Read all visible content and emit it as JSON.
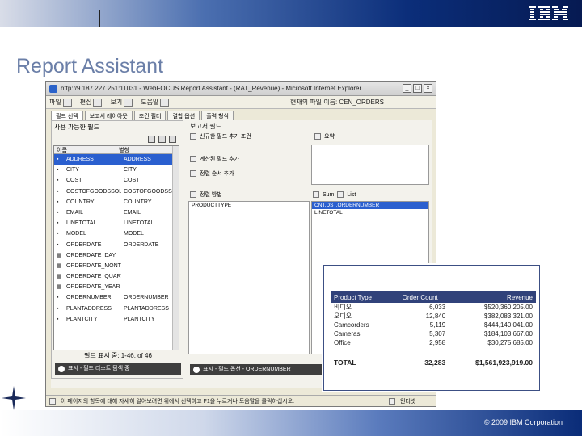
{
  "slide": {
    "title": "Report Assistant",
    "copyright": "© 2009 IBM Corporation",
    "logo": "IBM"
  },
  "window": {
    "title": "http://9.187.227.251:11031 - WebFOCUS Report Assistant - (RAT_Revenue) - Microsoft Internet Explorer",
    "min": "_",
    "max": "□",
    "close": "×"
  },
  "toolbar": {
    "file": "파일",
    "edit": "편집",
    "view": "보기",
    "help": "도움말",
    "active_file": "현재의 파일 이름: CEN_ORDERS"
  },
  "tabs": [
    "필드 선택",
    "보고서 레이아웃",
    "조건 필터",
    "결합 옵션",
    "출력 형식"
  ],
  "fields_panel": {
    "header": "사용 가능한 필드",
    "col_name": "이름",
    "col_alias": "별칭",
    "rows": [
      {
        "name": "ADDRESS",
        "alias": "ADDRESS",
        "selected": true,
        "icon": "field"
      },
      {
        "name": "CITY",
        "alias": "CITY",
        "selected": false,
        "icon": "field"
      },
      {
        "name": "COST",
        "alias": "COST",
        "selected": false,
        "icon": "field"
      },
      {
        "name": "COSTOFGOODSSOLD",
        "alias": "COSTOFGOODSSOLD",
        "selected": false,
        "icon": "field"
      },
      {
        "name": "COUNTRY",
        "alias": "COUNTRY",
        "selected": false,
        "icon": "field"
      },
      {
        "name": "EMAIL",
        "alias": "EMAIL",
        "selected": false,
        "icon": "field"
      },
      {
        "name": "LINETOTAL",
        "alias": "LINETOTAL",
        "selected": false,
        "icon": "field"
      },
      {
        "name": "MODEL",
        "alias": "MODEL",
        "selected": false,
        "icon": "field"
      },
      {
        "name": "ORDERDATE",
        "alias": "ORDERDATE",
        "selected": false,
        "icon": "field"
      },
      {
        "name": "ORDERDATE_DAY",
        "alias": "",
        "selected": false,
        "icon": "date"
      },
      {
        "name": "ORDERDATE_MONTH",
        "alias": "",
        "selected": false,
        "icon": "date"
      },
      {
        "name": "ORDERDATE_QUARTER",
        "alias": "",
        "selected": false,
        "icon": "date"
      },
      {
        "name": "ORDERDATE_YEAR",
        "alias": "",
        "selected": false,
        "icon": "date"
      },
      {
        "name": "ORDERNUMBER",
        "alias": "ORDERNUMBER",
        "selected": false,
        "icon": "field"
      },
      {
        "name": "PLANTADDRESS",
        "alias": "PLANTADDRESS",
        "selected": false,
        "icon": "field"
      },
      {
        "name": "PLANTCITY",
        "alias": "PLANTCITY",
        "selected": false,
        "icon": "field"
      }
    ],
    "count": "필드 표시 중: 1-46, of 46",
    "footer_btn": "표시 - 필드 리스트 탐색 중"
  },
  "right_panel": {
    "section_title": "보고서 필드",
    "compute_label": "신규한 필드 추가 조건",
    "summary_label": "요약",
    "check1": "계산된 필드 추가",
    "check2": "정렬 순서 추가",
    "sort_label": "정렬 방법",
    "sort_field": "PRODUCTTYPE",
    "sum_btn": "Sum",
    "list_btn": "List",
    "sum_items": [
      "CNT.DST.ORDERNUMBER",
      "LINETOTAL"
    ],
    "footer_btn": "표시 - 필드 옵션 - ORDERNUMBER"
  },
  "status_bar": {
    "tip": "이 페이지의 항목에 대해 자세히 알아보려면 위에서 선택하고 F1을 누르거나 도움말을 클릭하십시오.",
    "zone": "인터넷"
  },
  "report": {
    "columns": [
      "Product Type",
      "Order Count",
      "Revenue"
    ],
    "rows": [
      {
        "type": "비디오",
        "count": "6,033",
        "revenue": "$520,360,205.00"
      },
      {
        "type": "오디오",
        "count": "12,840",
        "revenue": "$382,083,321.00"
      },
      {
        "type": "Camcorders",
        "count": "5,119",
        "revenue": "$444,140,041.00"
      },
      {
        "type": "Cameras",
        "count": "5,307",
        "revenue": "$184,103,667.00"
      },
      {
        "type": "Office",
        "count": "2,958",
        "revenue": "$30,275,685.00"
      }
    ],
    "total_label": "TOTAL",
    "total_count": "32,283",
    "total_revenue": "$1,561,923,919.00"
  }
}
